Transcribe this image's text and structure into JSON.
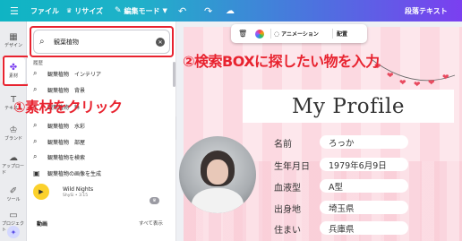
{
  "topbar": {
    "file": "ファイル",
    "resize": "リサイズ",
    "edit_mode": "編集モード",
    "doc_title": "段落テキスト"
  },
  "rail": {
    "items": [
      {
        "label": "デザイン",
        "icon": "layout-icon"
      },
      {
        "label": "素材",
        "icon": "elements-icon"
      },
      {
        "label": "テキスト",
        "icon": "text-icon"
      },
      {
        "label": "ブランド",
        "icon": "brand-icon"
      },
      {
        "label": "アップロード",
        "icon": "upload-icon"
      },
      {
        "label": "ツール",
        "icon": "draw-icon"
      },
      {
        "label": "プロジェクト",
        "icon": "folder-icon"
      }
    ]
  },
  "search": {
    "value": "観葉植物",
    "section_label": "履歴",
    "suggestions": [
      "観葉植物　インテリア",
      "観葉植物　背景",
      "観葉植物　鉢",
      "観葉植物　水彩",
      "観葉植物　部屋",
      "観葉植物を検索",
      "観葉植物の画像を生成"
    ]
  },
  "media": {
    "title": "Wild Nights",
    "subtitle": "ShySi • 3:15",
    "badge": "♛"
  },
  "videos": {
    "label": "動画",
    "see_all": "すべて表示"
  },
  "context_bar": {
    "animate": "アニメーション",
    "arrange": "配置"
  },
  "design": {
    "title": "My Profile",
    "fields": [
      {
        "label": "名前",
        "value": "ろっか"
      },
      {
        "label": "生年月日",
        "value": "1979年6月9日"
      },
      {
        "label": "血液型",
        "value": "A型"
      },
      {
        "label": "出身地",
        "value": "埼玉県"
      },
      {
        "label": "住まい",
        "value": "兵庫県"
      }
    ]
  },
  "annotations": {
    "step1": "①素材をクリック",
    "step2": "②検索BOXに探したい物を入力"
  },
  "colors": {
    "accent_red": "#e8232f",
    "brand_gradient_start": "#0fb4c4",
    "brand_gradient_end": "#7b3ff0"
  }
}
